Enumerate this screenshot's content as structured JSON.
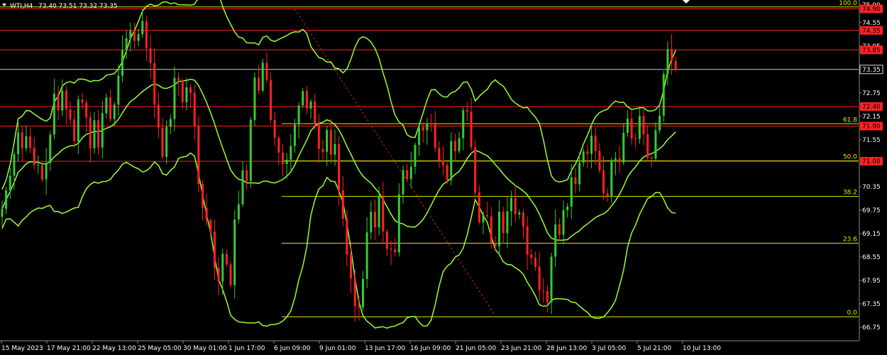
{
  "header": {
    "symbol": "WTI,H4",
    "ohlc": "73.40 73.51 73.32 73.35",
    "collapse_icon": "triangle-down-icon",
    "scroll_marker_icon": "triangle-down-icon"
  },
  "colors": {
    "background": "#000000",
    "bull": "#33cc33",
    "bear": "#ff2222",
    "band": "#99ff33",
    "resistance": "#ff2222",
    "fibonacci": "#e6e600",
    "current_price_line": "#cccccc",
    "trend_line": "#cc2222"
  },
  "chart_data": {
    "type": "candlestick",
    "symbol": "WTI",
    "timeframe": "H4",
    "ylim": [
      66.75,
      75.0
    ],
    "y_tick_labels": [
      "75.00",
      "74.55",
      "73.95",
      "73.35",
      "72.75",
      "72.15",
      "71.55",
      "70.95",
      "70.35",
      "69.75",
      "69.15",
      "68.55",
      "67.95",
      "67.35",
      "66.75"
    ],
    "x_tick_labels": [
      "15 May 2023",
      "17 May 21:00",
      "22 May 13:00",
      "25 May 05:00",
      "30 May 01:00",
      "1 Jun 17:00",
      "6 Jun 09:00",
      "9 Jun 01:00",
      "13 Jun 17:00",
      "16 Jun 09:00",
      "21 Jun 05:00",
      "23 Jun 21:00",
      "28 Jun 13:00",
      "3 Jul 05:00",
      "5 Jul 21:00",
      "10 Jul 13:00"
    ],
    "current_price": 73.35,
    "price_levels": [
      74.9,
      74.35,
      73.85,
      72.4,
      71.9,
      71.0
    ],
    "price_level_labels": [
      "74.90",
      "74.35",
      "73.85",
      "72.40",
      "71.90",
      "71.00"
    ],
    "fibonacci": [
      {
        "label": "100.0",
        "price": 74.95
      },
      {
        "label": "61.8",
        "price": 71.96
      },
      {
        "label": "50.0",
        "price": 71.01
      },
      {
        "label": "38.2",
        "price": 70.1
      },
      {
        "label": "23.6",
        "price": 68.9
      },
      {
        "label": "0.0",
        "price": 67.02
      }
    ],
    "trend_line": {
      "from": {
        "x_index": 73,
        "price": 74.9
      },
      "to": {
        "x_index": 123,
        "price": 67.05
      }
    },
    "close": [
      69.78,
      70.26,
      70.63,
      71.18,
      71.74,
      71.33,
      71.64,
      71.34,
      70.9,
      70.9,
      70.54,
      70.96,
      71.68,
      72.73,
      72.3,
      72.81,
      72.33,
      72.07,
      71.51,
      72.58,
      72.5,
      72.12,
      71.33,
      72.05,
      71.35,
      72.23,
      72.63,
      72.08,
      72.45,
      73.19,
      73.84,
      74.15,
      74.34,
      74.08,
      74.25,
      74.59,
      73.89,
      73.51,
      72.45,
      71.86,
      71.11,
      71.88,
      72.08,
      73.14,
      73.07,
      72.51,
      72.89,
      72.75,
      71.9,
      70.42,
      69.81,
      69.49,
      69.2,
      68.27,
      67.92,
      68.63,
      68.36,
      67.83,
      69.51,
      69.9,
      70.77,
      70.49,
      72.06,
      73.14,
      72.81,
      73.52,
      73.08,
      72.06,
      71.6,
      71.22,
      70.93,
      71.04,
      71.39,
      71.94,
      72.43,
      72.8,
      72.35,
      72.53,
      71.97,
      71.32,
      71.24,
      71.8,
      71.17,
      71.44,
      70.26,
      69.53,
      68.61,
      68.0,
      67.29,
      67.26,
      67.99,
      69.18,
      69.71,
      69.31,
      70.12,
      69.2,
      68.76,
      68.74,
      68.67,
      70.15,
      70.77,
      70.54,
      70.86,
      71.42,
      71.87,
      71.79,
      71.96,
      71.95,
      71.34,
      71.02,
      70.9,
      70.52,
      71.52,
      71.26,
      71.59,
      72.31,
      72.27,
      71.36,
      70.2,
      69.44,
      69.62,
      69.59,
      68.91,
      68.83,
      69.71,
      69.16,
      69.72,
      70.06,
      69.64,
      69.69,
      69.33,
      68.61,
      68.53,
      68.3,
      67.69,
      67.68,
      67.39,
      68.56,
      69.38,
      69.12,
      69.75,
      69.84,
      70.59,
      70.41,
      70.96,
      71.25,
      71.19,
      71.66,
      71.26,
      70.77,
      70.18,
      70.1,
      71.03,
      71.07,
      70.97,
      71.73,
      72.09,
      71.58,
      71.57,
      72.16,
      71.69,
      71.09,
      71.07,
      71.79,
      72.17,
      73.23,
      73.87,
      73.57,
      73.35
    ],
    "band_series": [
      "upper",
      "middle",
      "lower"
    ]
  }
}
